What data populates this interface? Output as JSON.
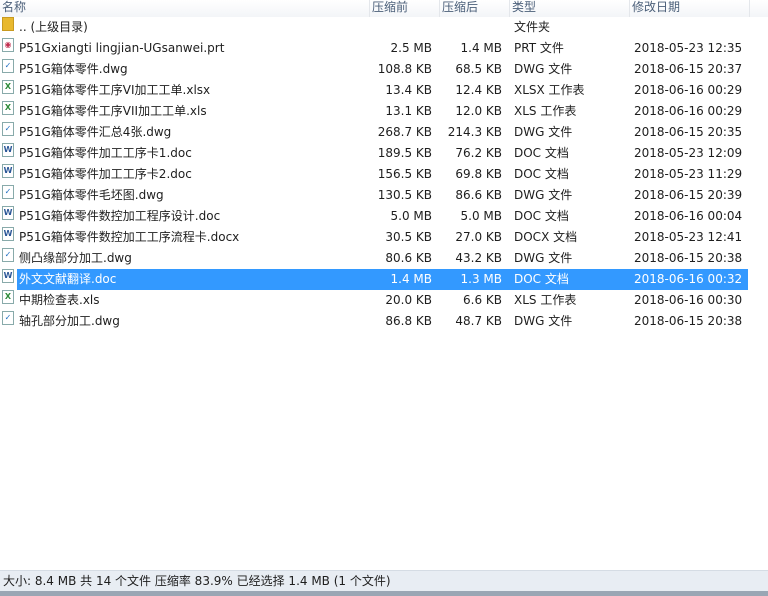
{
  "columns": {
    "name": "名称",
    "before": "压缩前",
    "after": "压缩后",
    "type": "类型",
    "date": "修改日期"
  },
  "files": [
    {
      "name": ".. (上级目录)",
      "before": "",
      "after": "",
      "type": "文件夹",
      "date": "",
      "icon": "folder-icon",
      "color": "#e8b82e",
      "glyph": ""
    },
    {
      "name": "P51Gxiangti lingjian-UGsanwei.prt",
      "before": "2.5 MB",
      "after": "1.4 MB",
      "type": "PRT 文件",
      "date": "2018-05-23 12:35",
      "icon": "prt-file-icon",
      "color": "#c03050",
      "glyph": "◉"
    },
    {
      "name": "P51G箱体零件.dwg",
      "before": "108.8 KB",
      "after": "68.5 KB",
      "type": "DWG 文件",
      "date": "2018-06-15 20:37",
      "icon": "dwg-file-icon",
      "color": "#1f6fc0",
      "glyph": "✓"
    },
    {
      "name": "P51G箱体零件工序VI加工工单.xlsx",
      "before": "13.4 KB",
      "after": "12.4 KB",
      "type": "XLSX 工作表",
      "date": "2018-06-16 00:29",
      "icon": "excel-file-icon",
      "color": "#2e8b3a",
      "glyph": "X"
    },
    {
      "name": "P51G箱体零件工序VII加工工单.xls",
      "before": "13.1 KB",
      "after": "12.0 KB",
      "type": "XLS 工作表",
      "date": "2018-06-16 00:29",
      "icon": "excel-file-icon",
      "color": "#2e8b3a",
      "glyph": "X"
    },
    {
      "name": "P51G箱体零件汇总4张.dwg",
      "before": "268.7 KB",
      "after": "214.3 KB",
      "type": "DWG 文件",
      "date": "2018-06-15 20:35",
      "icon": "dwg-file-icon",
      "color": "#1f6fc0",
      "glyph": "✓"
    },
    {
      "name": "P51G箱体零件加工工序卡1.doc",
      "before": "189.5 KB",
      "after": "76.2 KB",
      "type": "DOC 文档",
      "date": "2018-05-23 12:09",
      "icon": "word-file-icon",
      "color": "#2b5797",
      "glyph": "W"
    },
    {
      "name": "P51G箱体零件加工工序卡2.doc",
      "before": "156.5 KB",
      "after": "69.8 KB",
      "type": "DOC 文档",
      "date": "2018-05-23 11:29",
      "icon": "word-file-icon",
      "color": "#2b5797",
      "glyph": "W"
    },
    {
      "name": "P51G箱体零件毛坯图.dwg",
      "before": "130.5 KB",
      "after": "86.6 KB",
      "type": "DWG 文件",
      "date": "2018-06-15 20:39",
      "icon": "dwg-file-icon",
      "color": "#1f6fc0",
      "glyph": "✓"
    },
    {
      "name": "P51G箱体零件数控加工程序设计.doc",
      "before": "5.0 MB",
      "after": "5.0 MB",
      "type": "DOC 文档",
      "date": "2018-06-16 00:04",
      "icon": "word-file-icon",
      "color": "#2b5797",
      "glyph": "W"
    },
    {
      "name": "P51G箱体零件数控加工工序流程卡.docx",
      "before": "30.5 KB",
      "after": "27.0 KB",
      "type": "DOCX 文档",
      "date": "2018-05-23 12:41",
      "icon": "word-file-icon",
      "color": "#2b5797",
      "glyph": "W"
    },
    {
      "name": "侧凸缘部分加工.dwg",
      "before": "80.6 KB",
      "after": "43.2 KB",
      "type": "DWG 文件",
      "date": "2018-06-15 20:38",
      "icon": "dwg-file-icon",
      "color": "#1f6fc0",
      "glyph": "✓"
    },
    {
      "name": "外文文献翻译.doc",
      "before": "1.4 MB",
      "after": "1.3 MB",
      "type": "DOC 文档",
      "date": "2018-06-16 00:32",
      "icon": "word-file-icon",
      "color": "#2b5797",
      "glyph": "W",
      "selected": true
    },
    {
      "name": "中期检查表.xls",
      "before": "20.0 KB",
      "after": "6.6 KB",
      "type": "XLS 工作表",
      "date": "2018-06-16 00:30",
      "icon": "excel-file-icon",
      "color": "#2e8b3a",
      "glyph": "X"
    },
    {
      "name": "轴孔部分加工.dwg",
      "before": "86.8 KB",
      "after": "48.7 KB",
      "type": "DWG 文件",
      "date": "2018-06-15 20:38",
      "icon": "dwg-file-icon",
      "color": "#1f6fc0",
      "glyph": "✓"
    }
  ],
  "status": "大小: 8.4 MB 共 14 个文件 压缩率 83.9% 已经选择 1.4 MB (1 个文件)",
  "colors": {
    "selection": "#3399ff"
  }
}
